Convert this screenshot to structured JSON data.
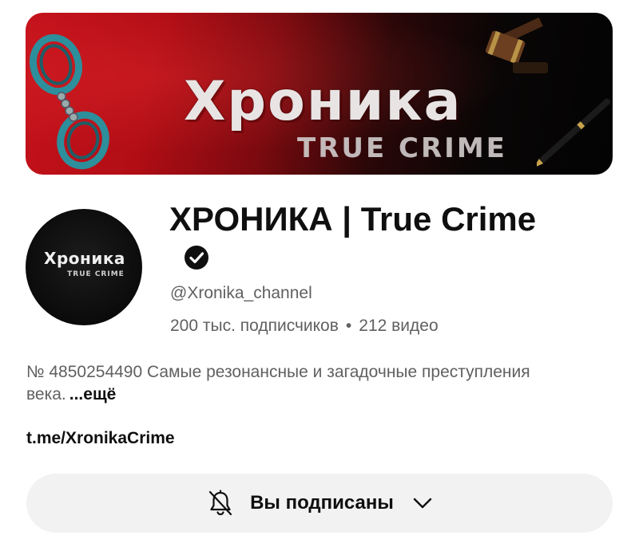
{
  "banner": {
    "title": "Хроника",
    "subtitle": "TRUE CRIME"
  },
  "avatar": {
    "title": "Хроника",
    "subtitle": "TRUE CRIME"
  },
  "channel": {
    "name": "ХРОНИКА | True Crime",
    "verified_icon": "verified-check-icon",
    "handle": "@Xronika_channel",
    "subscribers": "200 тыс. подписчиков",
    "separator": "•",
    "videos": "212 видео"
  },
  "description": {
    "text": "№ 4850254490 Самые резонансные и загадочные преступления века.",
    "more_label": "...ещё"
  },
  "link": {
    "text": "t.me/XronikaCrime"
  },
  "subscribe_button": {
    "label": "Вы подписаны",
    "bell_icon": "bell-off-icon",
    "chevron_icon": "chevron-down-icon"
  },
  "colors": {
    "banner_red": "#c4121b",
    "text_primary": "#0f0f0f",
    "text_secondary": "#606060",
    "button_bg": "#f2f2f2"
  }
}
